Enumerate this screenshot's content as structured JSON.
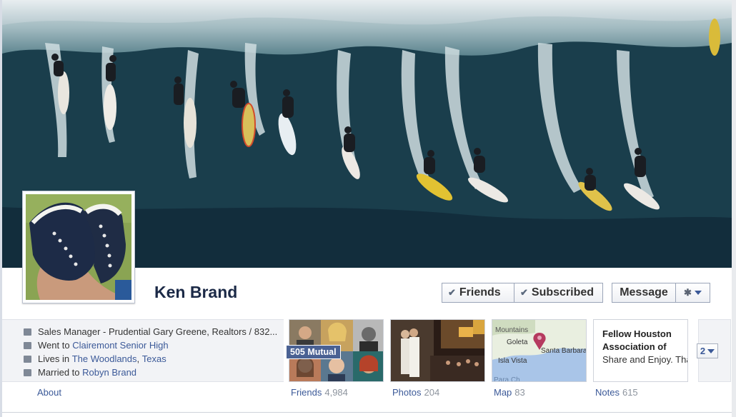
{
  "profile": {
    "name": "Ken Brand"
  },
  "actions": {
    "friends_label": "Friends",
    "subscribed_label": "Subscribed",
    "message_label": "Message",
    "check_icon": "check-icon",
    "gear_icon": "gear-icon"
  },
  "info": {
    "work": "Sales Manager - Prudential Gary Greene, Realtors / 832...",
    "school_prefix": "Went to",
    "school": "Clairemont Senior High",
    "lives_prefix": "Lives in",
    "city": "The Woodlands",
    "state": "Texas",
    "comma": ",",
    "married_prefix": "Married to",
    "spouse": "Robyn Brand",
    "about_label": "About"
  },
  "tiles": {
    "friends": {
      "label": "Friends",
      "count": "4,984",
      "mutual": "505 Mutual"
    },
    "photos": {
      "label": "Photos",
      "count": "204"
    },
    "map": {
      "label": "Map",
      "count": "83",
      "place1": "Mountains",
      "place2": "Goleta",
      "place3": "Santa Barbara",
      "place4": "Isla Vista",
      "place5": "Para Ch"
    },
    "notes": {
      "label": "Notes",
      "count": "615",
      "title": "Fellow Houston Association of",
      "body": "Share and Enjoy. Tha"
    },
    "more": {
      "label": "2"
    }
  },
  "colors": {
    "link": "#3b5998",
    "name": "#1c2a47",
    "mutual_bg": "#4a6193"
  }
}
